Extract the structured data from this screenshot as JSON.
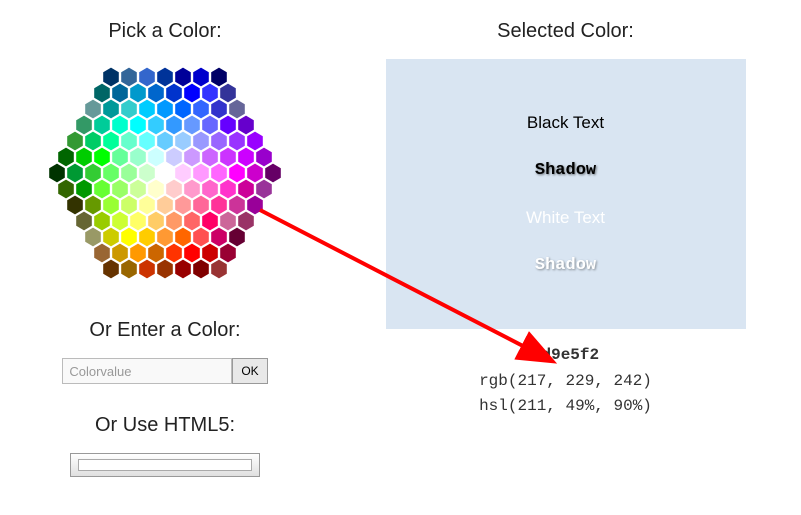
{
  "left": {
    "pick_title": "Pick a Color:",
    "enter_title": "Or Enter a Color:",
    "input_placeholder": "Colorvalue",
    "ok_label": "OK",
    "html5_title": "Or Use HTML5:"
  },
  "right": {
    "selected_title": "Selected Color:",
    "preview_bg": "#d9e5f2",
    "samples": {
      "black": "Black Text",
      "shadow_dark": "Shadow",
      "white": "White Text",
      "shadow_light": "Shadow"
    },
    "codes": {
      "hex": "#d9e5f2",
      "rgb": "rgb(217, 229, 242)",
      "hsl": "hsl(211, 49%, 90%)"
    }
  },
  "arrow_color": "#ff0000",
  "hex_colors": [
    [
      "#003366",
      "#336699",
      "#3366cc",
      "#003399",
      "#000099",
      "#0000cc",
      "#000066"
    ],
    [
      "#006666",
      "#006699",
      "#0099cc",
      "#0066cc",
      "#0033cc",
      "#0000ff",
      "#3333ff",
      "#333399"
    ],
    [
      "#669999",
      "#009999",
      "#33cccc",
      "#00ccff",
      "#0099ff",
      "#0066ff",
      "#3366ff",
      "#3333cc",
      "#666699"
    ],
    [
      "#339966",
      "#00cc99",
      "#00ffcc",
      "#00ffff",
      "#33ccff",
      "#3399ff",
      "#6699ff",
      "#6666ff",
      "#6600ff",
      "#6600cc"
    ],
    [
      "#339933",
      "#00cc66",
      "#00ff99",
      "#66ffcc",
      "#66ffff",
      "#66ccff",
      "#99ccff",
      "#9999ff",
      "#9966ff",
      "#9933ff",
      "#9900ff"
    ],
    [
      "#006600",
      "#00cc00",
      "#00ff00",
      "#66ff99",
      "#99ffcc",
      "#ccffff",
      "#ccccff",
      "#cc99ff",
      "#cc66ff",
      "#cc33ff",
      "#cc00ff",
      "#9900cc"
    ],
    [
      "#003300",
      "#009933",
      "#33cc33",
      "#66ff66",
      "#99ff99",
      "#ccffcc",
      "#ffffff",
      "#ffccff",
      "#ff99ff",
      "#ff66ff",
      "#ff00ff",
      "#cc00cc",
      "#660066"
    ],
    [
      "#336600",
      "#009900",
      "#66ff33",
      "#99ff66",
      "#ccff99",
      "#ffffcc",
      "#ffcccc",
      "#ff99cc",
      "#ff66cc",
      "#ff33cc",
      "#cc0099",
      "#993399"
    ],
    [
      "#333300",
      "#669900",
      "#99ff33",
      "#ccff66",
      "#ffff99",
      "#ffcc99",
      "#ff9999",
      "#ff6699",
      "#ff3399",
      "#cc3399",
      "#990099"
    ],
    [
      "#666633",
      "#99cc00",
      "#ccff33",
      "#ffff66",
      "#ffcc66",
      "#ff9966",
      "#ff6666",
      "#ff0066",
      "#cc6699",
      "#993366"
    ],
    [
      "#999966",
      "#cccc00",
      "#ffff00",
      "#ffcc00",
      "#ff9933",
      "#ff6600",
      "#ff5050",
      "#cc0066",
      "#660033"
    ],
    [
      "#996633",
      "#cc9900",
      "#ff9900",
      "#cc6600",
      "#ff3300",
      "#ff0000",
      "#cc0000",
      "#990033"
    ],
    [
      "#663300",
      "#996600",
      "#cc3300",
      "#993300",
      "#990000",
      "#800000",
      "#993333"
    ]
  ]
}
